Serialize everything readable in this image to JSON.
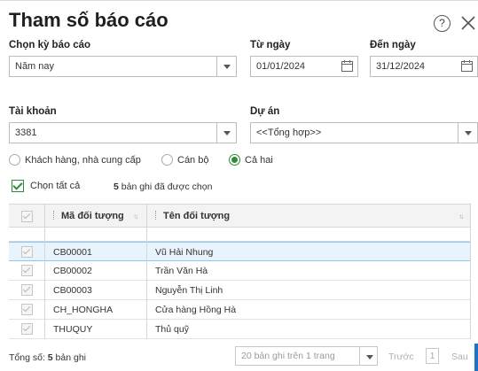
{
  "dialog": {
    "title": "Tham số báo cáo",
    "help_glyph": "?"
  },
  "report_period": {
    "label": "Chọn kỳ báo cáo",
    "value": "Năm nay"
  },
  "from_date": {
    "label": "Từ ngày",
    "value": "01/01/2024"
  },
  "to_date": {
    "label": "Đến ngày",
    "value": "31/12/2024"
  },
  "account": {
    "label": "Tài khoản",
    "value": "3381"
  },
  "project": {
    "label": "Dự án",
    "value": "<<Tổng hợp>>"
  },
  "object_type": {
    "options": [
      {
        "label": "Khách hàng, nhà cung cấp",
        "selected": false
      },
      {
        "label": "Cán bộ",
        "selected": false
      },
      {
        "label": "Cả hai",
        "selected": true
      }
    ]
  },
  "select_all": {
    "label": "Chọn tất cả",
    "checked": true
  },
  "selection_info": {
    "count": "5",
    "text": "bản ghi đã được chọn"
  },
  "table": {
    "columns": [
      "Mã đối tượng",
      "Tên đối tượng"
    ],
    "rows": [
      {
        "code": "CB00001",
        "name": "Vũ Hải Nhung",
        "selected": true
      },
      {
        "code": "CB00002",
        "name": "Trần Văn Hà",
        "selected": false
      },
      {
        "code": "CB00003",
        "name": "Nguyễn Thị Linh",
        "selected": false
      },
      {
        "code": "CH_HONGHA",
        "name": "Cửa hàng Hồng Hà",
        "selected": false
      },
      {
        "code": "THUQUY",
        "name": "Thủ quỹ",
        "selected": false
      }
    ]
  },
  "footer": {
    "total_label": "Tổng số:",
    "total_count": "5",
    "total_unit": "bản ghi",
    "page_size": "20 bản ghi trên 1 trang",
    "prev_label": "Trước",
    "page_number": "1",
    "next_label": "Sau"
  },
  "colors": {
    "accent_green": "#2e8b3a",
    "selected_row": "#e8f4fd",
    "edge_blue": "#1a73c8"
  }
}
